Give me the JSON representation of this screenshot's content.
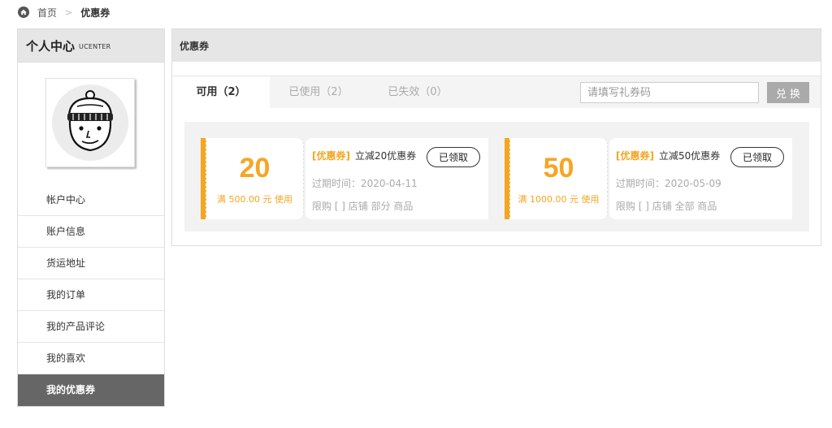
{
  "breadcrumb": {
    "home": "首页",
    "separator": ">",
    "current": "优惠券"
  },
  "sidebar": {
    "title": "个人中心",
    "subtitle": "UCENTER",
    "menu": [
      {
        "label": "帐户中心"
      },
      {
        "label": "账户信息"
      },
      {
        "label": "货运地址"
      },
      {
        "label": "我的订单"
      },
      {
        "label": "我的产品评论"
      },
      {
        "label": "我的喜欢"
      },
      {
        "label": "我的优惠券"
      }
    ],
    "active_index": 6
  },
  "main": {
    "title": "优惠券",
    "tabs": [
      {
        "label": "可用（2）"
      },
      {
        "label": "已使用（2）"
      },
      {
        "label": "已失效（0）"
      }
    ],
    "active_tab": 0,
    "code_input": {
      "placeholder": "请填写礼券码",
      "value": ""
    },
    "redeem_label": "兑换",
    "coupons": [
      {
        "amount": "20",
        "condition": "满 500.00 元 使用",
        "tag": "[优惠券]",
        "name": "立减20优惠券",
        "button": "已领取",
        "expire": "过期时间：2020-04-11",
        "limit": "限购 [ ] 店铺 部分 商品"
      },
      {
        "amount": "50",
        "condition": "满 1000.00 元 使用",
        "tag": "[优惠券]",
        "name": "立减50优惠券",
        "button": "已领取",
        "expire": "过期时间：2020-05-09",
        "limit": "限购 [ ] 店铺 全部 商品"
      }
    ]
  },
  "colors": {
    "accent": "#f5a623",
    "active_menu_bg": "#666666",
    "header_bg": "#e6e6e6",
    "button_gray": "#aaaaaa"
  },
  "icons": {
    "home": "home-icon",
    "avatar": "avatar-illustration"
  }
}
